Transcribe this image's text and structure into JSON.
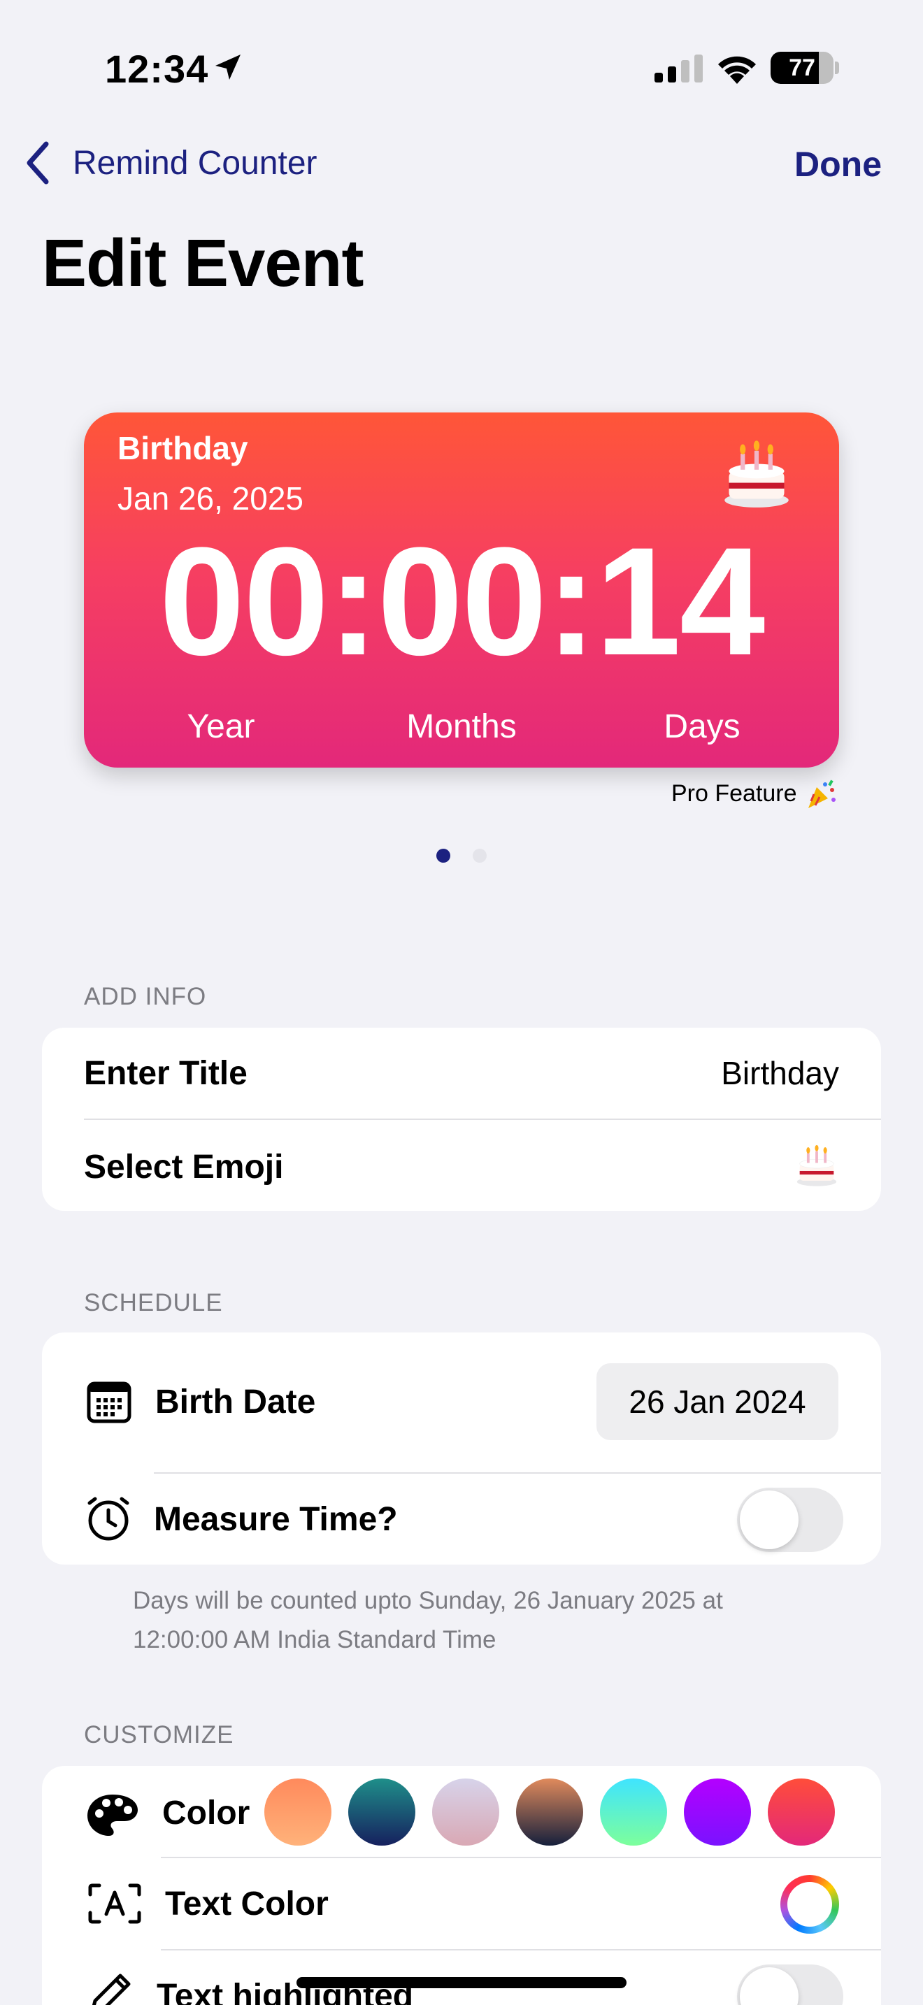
{
  "status_bar": {
    "time": "12:34",
    "battery": "77",
    "battery_level": 0.77
  },
  "nav": {
    "back_label": "Remind Counter",
    "done_label": "Done"
  },
  "page_title": "Edit Event",
  "widget": {
    "title": "Birthday",
    "date": "Jan 26, 2025",
    "counter": "00:00:14",
    "labels": [
      "Year",
      "Months",
      "Days"
    ],
    "emoji": "cake-emoji",
    "gradient": [
      "#ff5638",
      "#e3287a"
    ]
  },
  "pro_feature": {
    "label": "Pro Feature",
    "icon": "party-popper-icon"
  },
  "page_dots": {
    "count": 2,
    "active": 0
  },
  "add_info": {
    "header": "ADD INFO",
    "title_label": "Enter Title",
    "title_value": "Birthday",
    "emoji_label": "Select Emoji",
    "emoji_value": "cake-emoji"
  },
  "schedule": {
    "header": "SCHEDULE",
    "birth_date_label": "Birth Date",
    "birth_date_value": "26 Jan 2024",
    "measure_time_label": "Measure Time?",
    "measure_time_on": false,
    "footnote_line1": "Days will be counted upto  Sunday, 26 January 2025 at",
    "footnote_line2": "12:00:00 AM India Standard Time"
  },
  "customize": {
    "header": "CUSTOMIZE",
    "color_label": "Color",
    "swatches": [
      [
        "#ff8a5c",
        "#ffb27a"
      ],
      [
        "#1f8f8a",
        "#16205e"
      ],
      [
        "#d7d3ea",
        "#d9a8b4"
      ],
      [
        "#e08a5c",
        "#16203c"
      ],
      [
        "#3fe4ff",
        "#7dff9b"
      ],
      [
        "#b400ff",
        "#7a12ff"
      ],
      [
        "#ff4d3a",
        "#e3287a"
      ]
    ],
    "text_color_label": "Text Color",
    "text_highlighted_label": "Text highlighted",
    "text_highlighted_on": false
  },
  "accent": "#1c2180"
}
